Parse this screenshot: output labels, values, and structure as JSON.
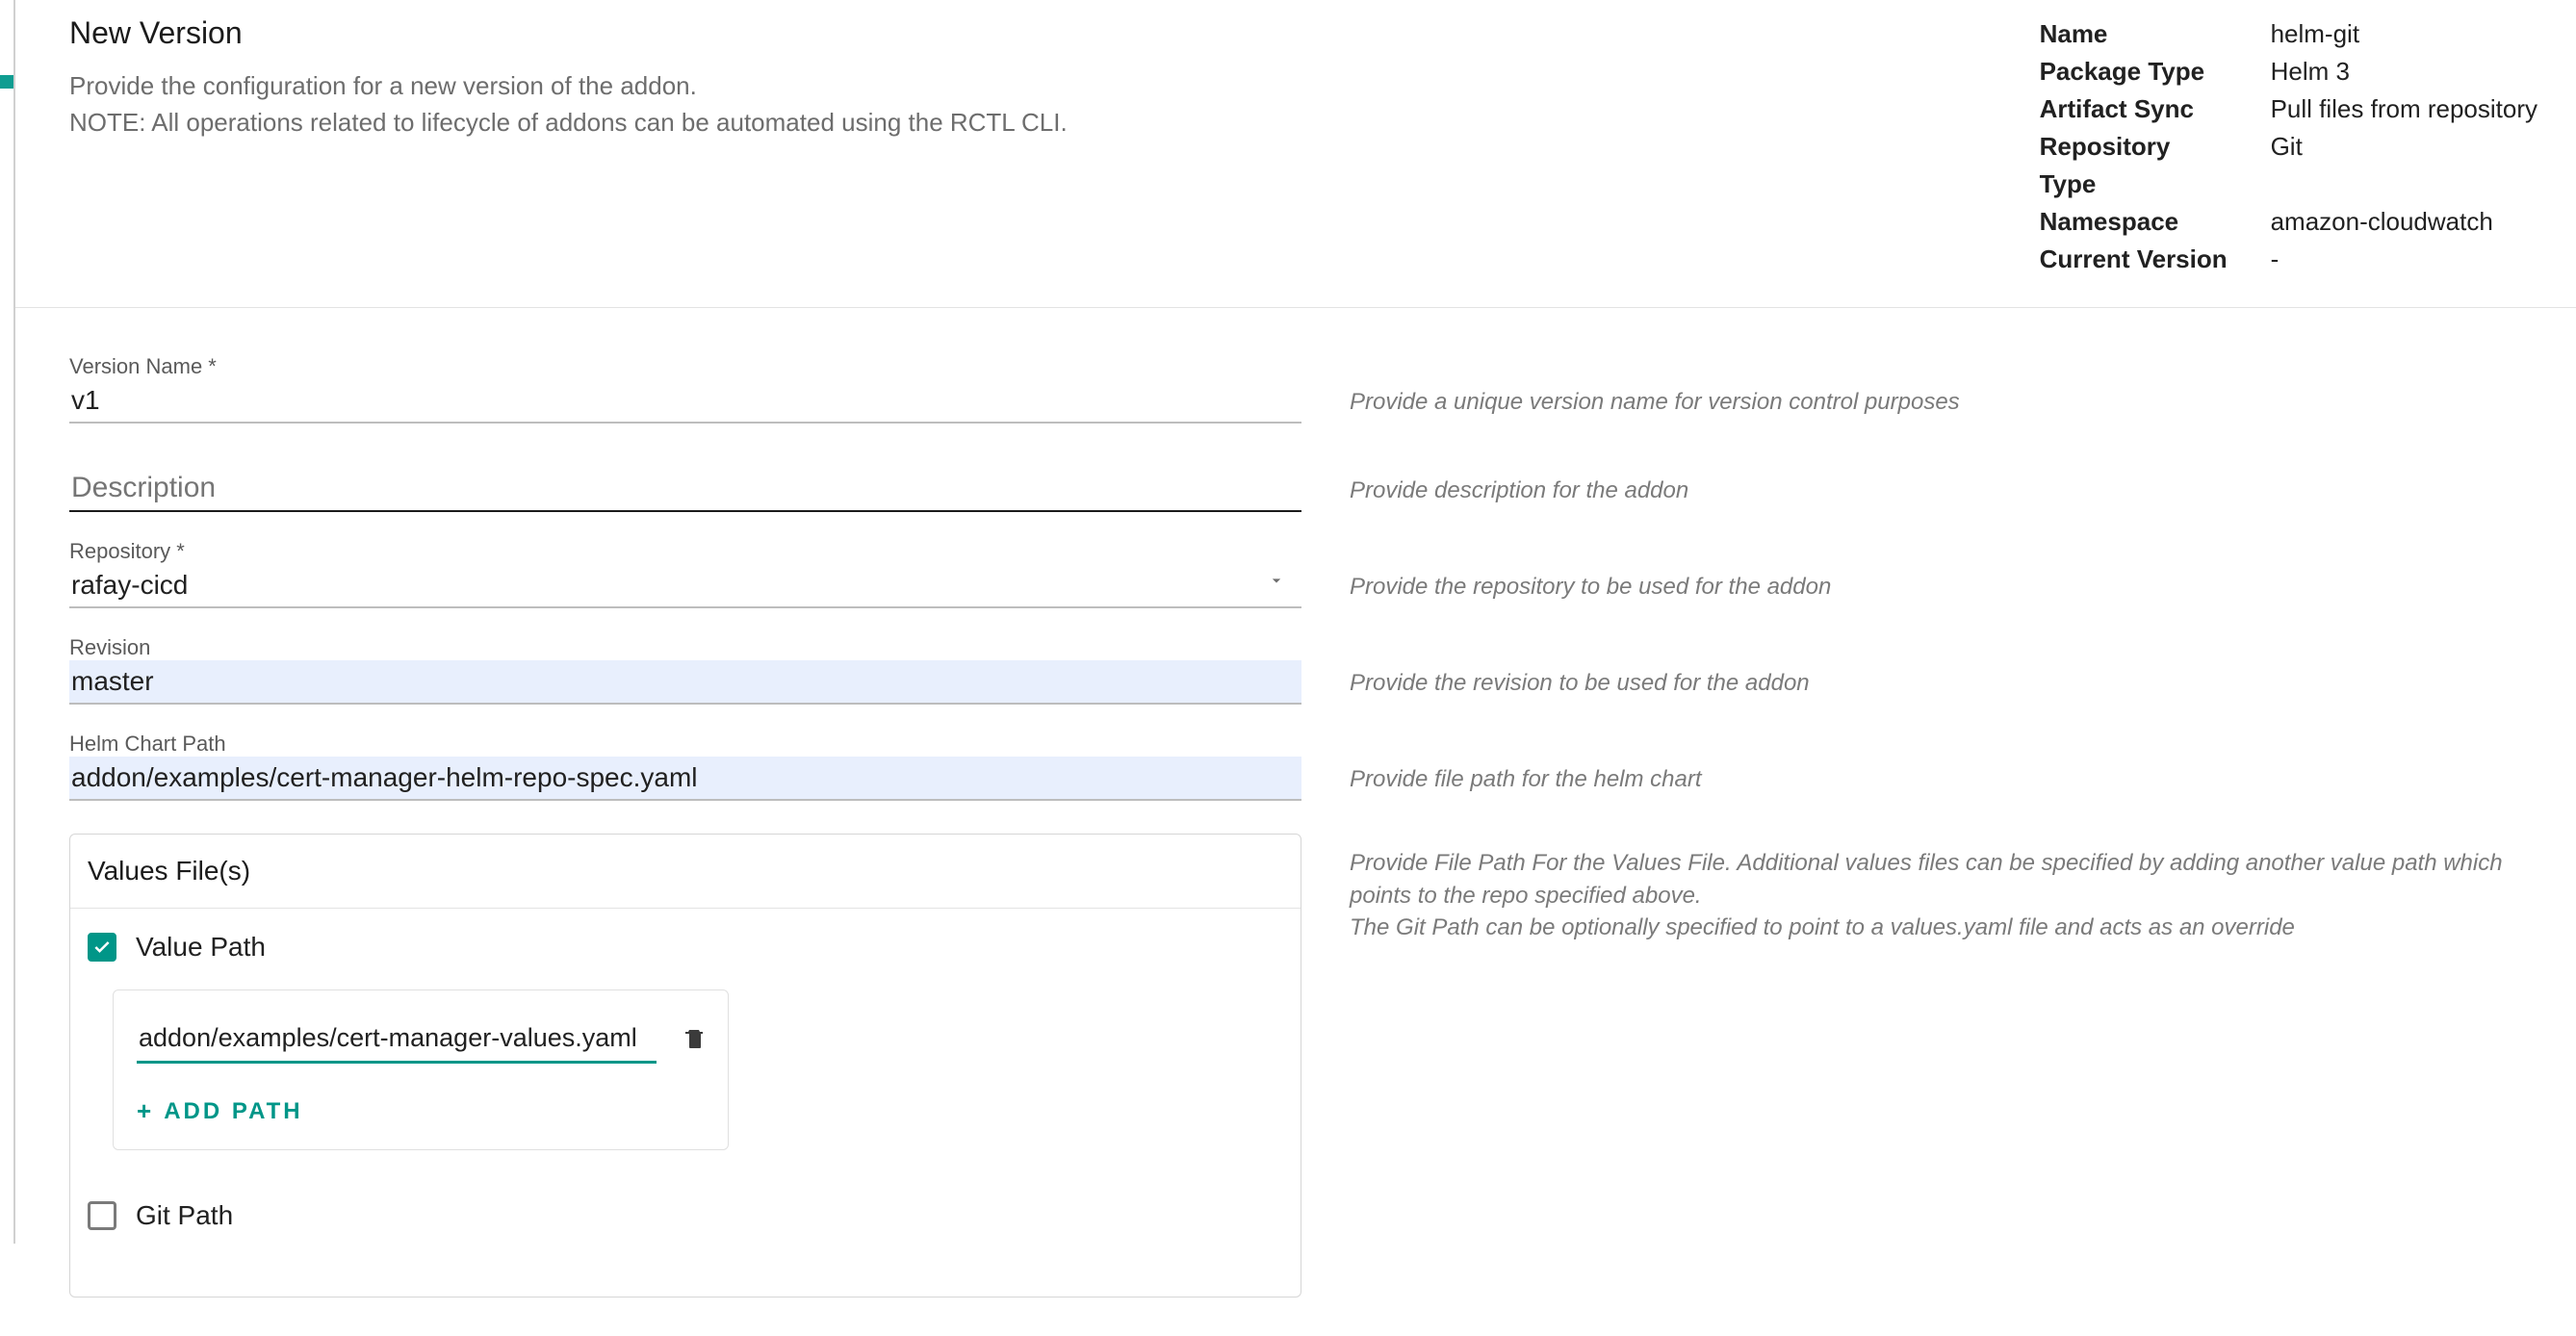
{
  "header": {
    "title": "New Version",
    "sub_line1": "Provide the configuration for a new version of the addon.",
    "sub_line2": "NOTE: All operations related to lifecycle of addons can be automated using the RCTL CLI."
  },
  "meta": {
    "name_label": "Name",
    "name_value": "helm-git",
    "package_type_label": "Package Type",
    "package_type_value": "Helm 3",
    "artifact_sync_label": "Artifact Sync",
    "artifact_sync_value": "Pull files from repository",
    "repo_type_label": "Repository Type",
    "repo_type_value": "Git",
    "namespace_label": "Namespace",
    "namespace_value": "amazon-cloudwatch",
    "current_version_label": "Current Version",
    "current_version_value": "-"
  },
  "form": {
    "version_name": {
      "label": "Version Name *",
      "value": "v1",
      "hint": "Provide a unique version name for version control purposes"
    },
    "description": {
      "label": "Description",
      "value": "",
      "hint": "Provide description for the addon"
    },
    "repository": {
      "label": "Repository *",
      "value": "rafay-cicd",
      "hint": "Provide the repository to be used for the addon"
    },
    "revision": {
      "label": "Revision",
      "value": "master",
      "hint": "Provide the revision to be used for the addon"
    },
    "helm_path": {
      "label": "Helm Chart Path",
      "value": "addon/examples/cert-manager-helm-repo-spec.yaml",
      "hint": "Provide file path for the helm chart"
    }
  },
  "values_section": {
    "title": "Values File(s)",
    "value_path_label": "Value Path",
    "value_path_checked": true,
    "paths": [
      "addon/examples/cert-manager-values.yaml"
    ],
    "add_path_label": "ADD  PATH",
    "git_path_label": "Git Path",
    "git_path_checked": false,
    "hint_line1": "Provide File Path For the Values File. Additional values files can be specified by adding another value path which points to the repo specified above.",
    "hint_line2": "The Git Path can be optionally specified to point to a values.yaml file and acts as an override"
  }
}
